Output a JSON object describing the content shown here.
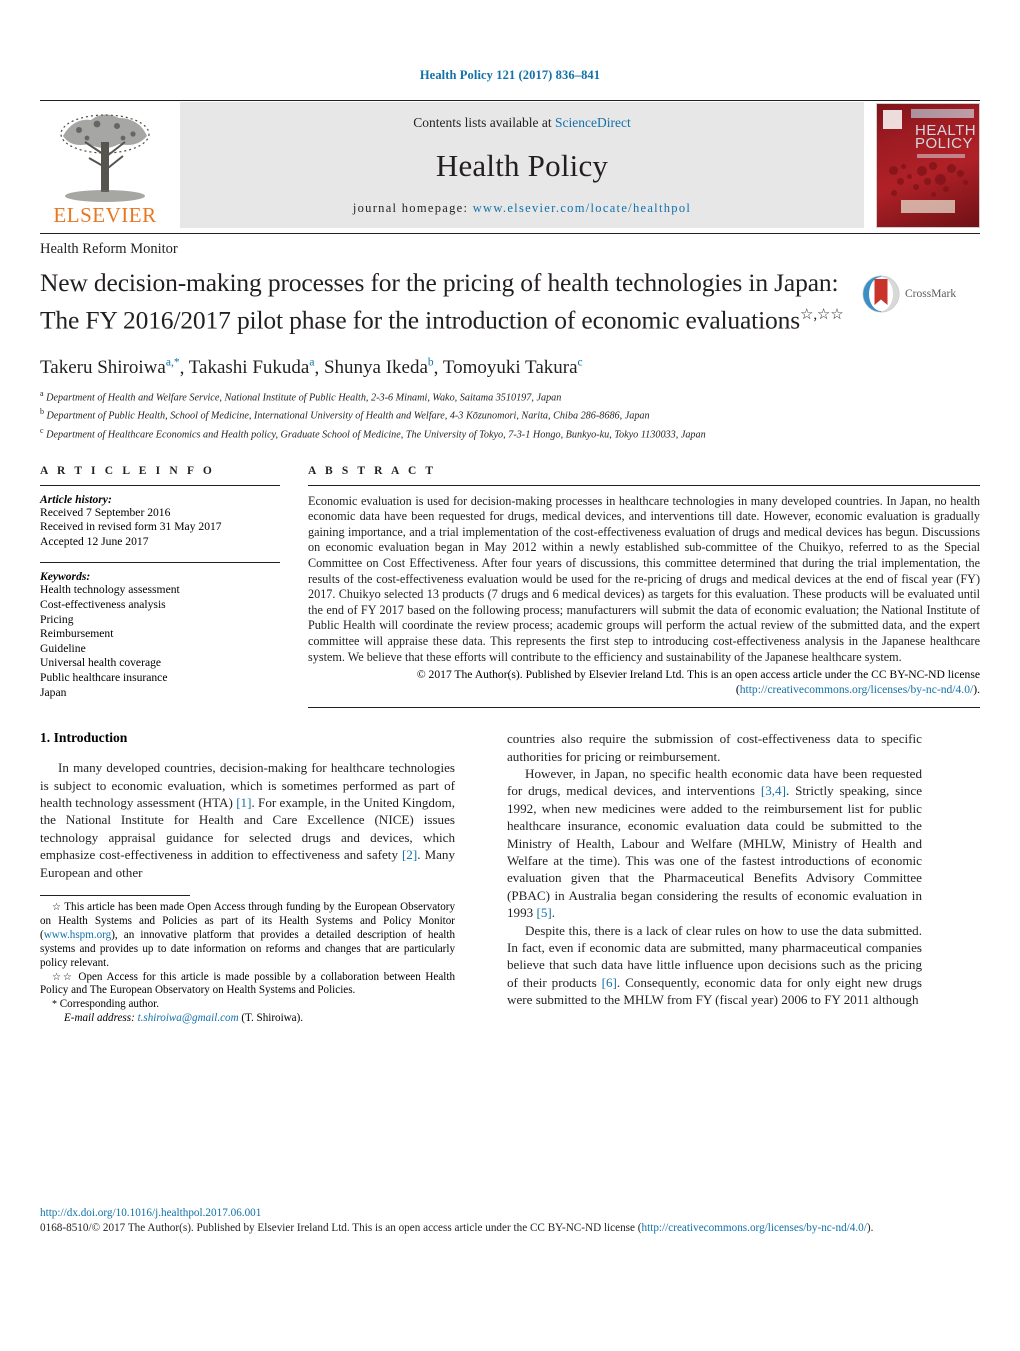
{
  "running_head": "Health Policy 121 (2017) 836–841",
  "masthead": {
    "contents_prefix": "Contents lists available at ",
    "sciencedirect": "ScienceDirect",
    "journal_name": "Health Policy",
    "homepage_prefix": "journal homepage: ",
    "homepage_url": "www.elsevier.com/locate/healthpol",
    "publisher_logo_text": "ELSEVIER",
    "cover_title_line1": "HEALTH",
    "cover_title_line2": "POLICY"
  },
  "article": {
    "section_type": "Health Reform Monitor",
    "title": "New decision-making processes for the pricing of health technologies in Japan: The FY 2016/2017 pilot phase for the introduction of economic evaluations",
    "title_marks": "☆,☆☆",
    "crossmark_label": "CrossMark",
    "authors": [
      {
        "name": "Takeru Shiroiwa",
        "sup": "a,*"
      },
      {
        "name": "Takashi Fukuda",
        "sup": "a"
      },
      {
        "name": "Shunya Ikeda",
        "sup": "b"
      },
      {
        "name": "Tomoyuki Takura",
        "sup": "c"
      }
    ],
    "affiliations": [
      {
        "mark": "a",
        "text": "Department of Health and Welfare Service, National Institute of Public Health, 2-3-6 Minami, Wako, Saitama 3510197, Japan"
      },
      {
        "mark": "b",
        "text": "Department of Public Health, School of Medicine, International University of Health and Welfare, 4-3 Kōzunomori, Narita, Chiba 286-8686, Japan"
      },
      {
        "mark": "c",
        "text": "Department of Healthcare Economics and Health policy, Graduate School of Medicine, The University of Tokyo, 7-3-1 Hongo, Bunkyo-ku, Tokyo 1130033, Japan"
      }
    ]
  },
  "article_info": {
    "heading": "A R T I C L E   I N F O",
    "history_label": "Article history:",
    "history": [
      "Received 7 September 2016",
      "Received in revised form 31 May 2017",
      "Accepted 12 June 2017"
    ],
    "keywords_label": "Keywords:",
    "keywords": [
      "Health technology assessment",
      "Cost-effectiveness analysis",
      "Pricing",
      "Reimbursement",
      "Guideline",
      "Universal health coverage",
      "Public healthcare insurance",
      "Japan"
    ]
  },
  "abstract": {
    "heading": "A B S T R A C T",
    "text": "Economic evaluation is used for decision-making processes in healthcare technologies in many developed countries. In Japan, no health economic data have been requested for drugs, medical devices, and interventions till date. However, economic evaluation is gradually gaining importance, and a trial implementation of the cost-effectiveness evaluation of drugs and medical devices has begun. Discussions on economic evaluation began in May 2012 within a newly established sub-committee of the Chuikyo, referred to as the Special Committee on Cost Effectiveness. After four years of discussions, this committee determined that during the trial implementation, the results of the cost-effectiveness evaluation would be used for the re-pricing of drugs and medical devices at the end of fiscal year (FY) 2017. Chuikyo selected 13 products (7 drugs and 6 medical devices) as targets for this evaluation. These products will be evaluated until the end of FY 2017 based on the following process; manufacturers will submit the data of economic evaluation; the National Institute of Public Health will coordinate the review process; academic groups will perform the actual review of the submitted data, and the expert committee will appraise these data. This represents the first step to introducing cost-effectiveness analysis in the Japanese healthcare system. We believe that these efforts will contribute to the efficiency and sustainability of the Japanese healthcare system.",
    "copyright_pre": "© 2017 The Author(s). Published by Elsevier Ireland Ltd. This is an open access article under the CC BY-NC-ND license (",
    "copyright_link": "http://creativecommons.org/licenses/by-nc-nd/4.0/",
    "copyright_post": ")."
  },
  "introduction": {
    "heading": "1. Introduction",
    "paragraphs_left": [
      {
        "parts": [
          {
            "t": "In many developed countries, decision-making for healthcare technologies is subject to economic evaluation, which is sometimes performed as part of health technology assessment (HTA) "
          },
          {
            "t": "[1]",
            "ref": true
          },
          {
            "t": ". For example, in the United Kingdom, the National Institute for Health and Care Excellence (NICE) issues technology appraisal guidance for selected drugs and devices, which emphasize cost-effectiveness in addition to effectiveness and safety "
          },
          {
            "t": "[2]",
            "ref": true
          },
          {
            "t": ". Many European and other"
          }
        ]
      }
    ],
    "paragraphs_right": [
      {
        "indent": false,
        "parts": [
          {
            "t": "countries also require the submission of cost-effectiveness data to specific authorities for pricing or reimbursement."
          }
        ]
      },
      {
        "indent": true,
        "parts": [
          {
            "t": "However, in Japan, no specific health economic data have been requested for drugs, medical devices, and interventions "
          },
          {
            "t": "[3,4]",
            "ref": true
          },
          {
            "t": ". Strictly speaking, since 1992, when new medicines were added to the reimbursement list for public healthcare insurance, economic evaluation data could be submitted to the Ministry of Health, Labour and Welfare (MHLW, Ministry of Health and Welfare at the time). This was one of the fastest introductions of economic evaluation given that the Pharmaceutical Benefits Advisory Committee (PBAC) in Australia began considering the results of economic evaluation in 1993 "
          },
          {
            "t": "[5]",
            "ref": true
          },
          {
            "t": "."
          }
        ]
      },
      {
        "indent": true,
        "parts": [
          {
            "t": "Despite this, there is a lack of clear rules on how to use the data submitted. In fact, even if economic data are submitted, many pharmaceutical companies believe that such data have little influence upon decisions such as the pricing of their products "
          },
          {
            "t": "[6]",
            "ref": true
          },
          {
            "t": ". Consequently, economic data for only eight new drugs were submitted to the MHLW from FY (fiscal year) 2006 to FY 2011 although"
          }
        ]
      }
    ]
  },
  "footnotes": {
    "note1_mark": "☆",
    "note1_pre": " This article has been made Open Access through funding by the European Observatory on Health Systems and Policies as part of its Health Systems and Policy Monitor (",
    "note1_link": "www.hspm.org",
    "note1_post": "), an innovative platform that provides a detailed description of health systems and provides up to date information on reforms and changes that are particularly policy relevant.",
    "note2_mark": "☆☆",
    "note2_text": " Open Access for this article is made possible by a collaboration between Health Policy and The European Observatory on Health Systems and Policies.",
    "note3_mark": "*",
    "note3_text": " Corresponding author.",
    "email_label": "E-mail address:",
    "email": "t.shiroiwa@gmail.com",
    "email_owner": "(T. Shiroiwa)."
  },
  "bottom": {
    "doi": "http://dx.doi.org/10.1016/j.healthpol.2017.06.001",
    "issn_pre": "0168-8510/© 2017 The Author(s). Published by Elsevier Ireland Ltd. This is an open access article under the CC BY-NC-ND license (",
    "issn_link": "http://creativecommons.org/licenses/by-nc-nd/4.0/",
    "issn_post": ")."
  },
  "colors": {
    "link": "#1171a8",
    "elsevier_orange": "#e87722",
    "cover_red": "#9d1b22",
    "text": "#231f20"
  }
}
